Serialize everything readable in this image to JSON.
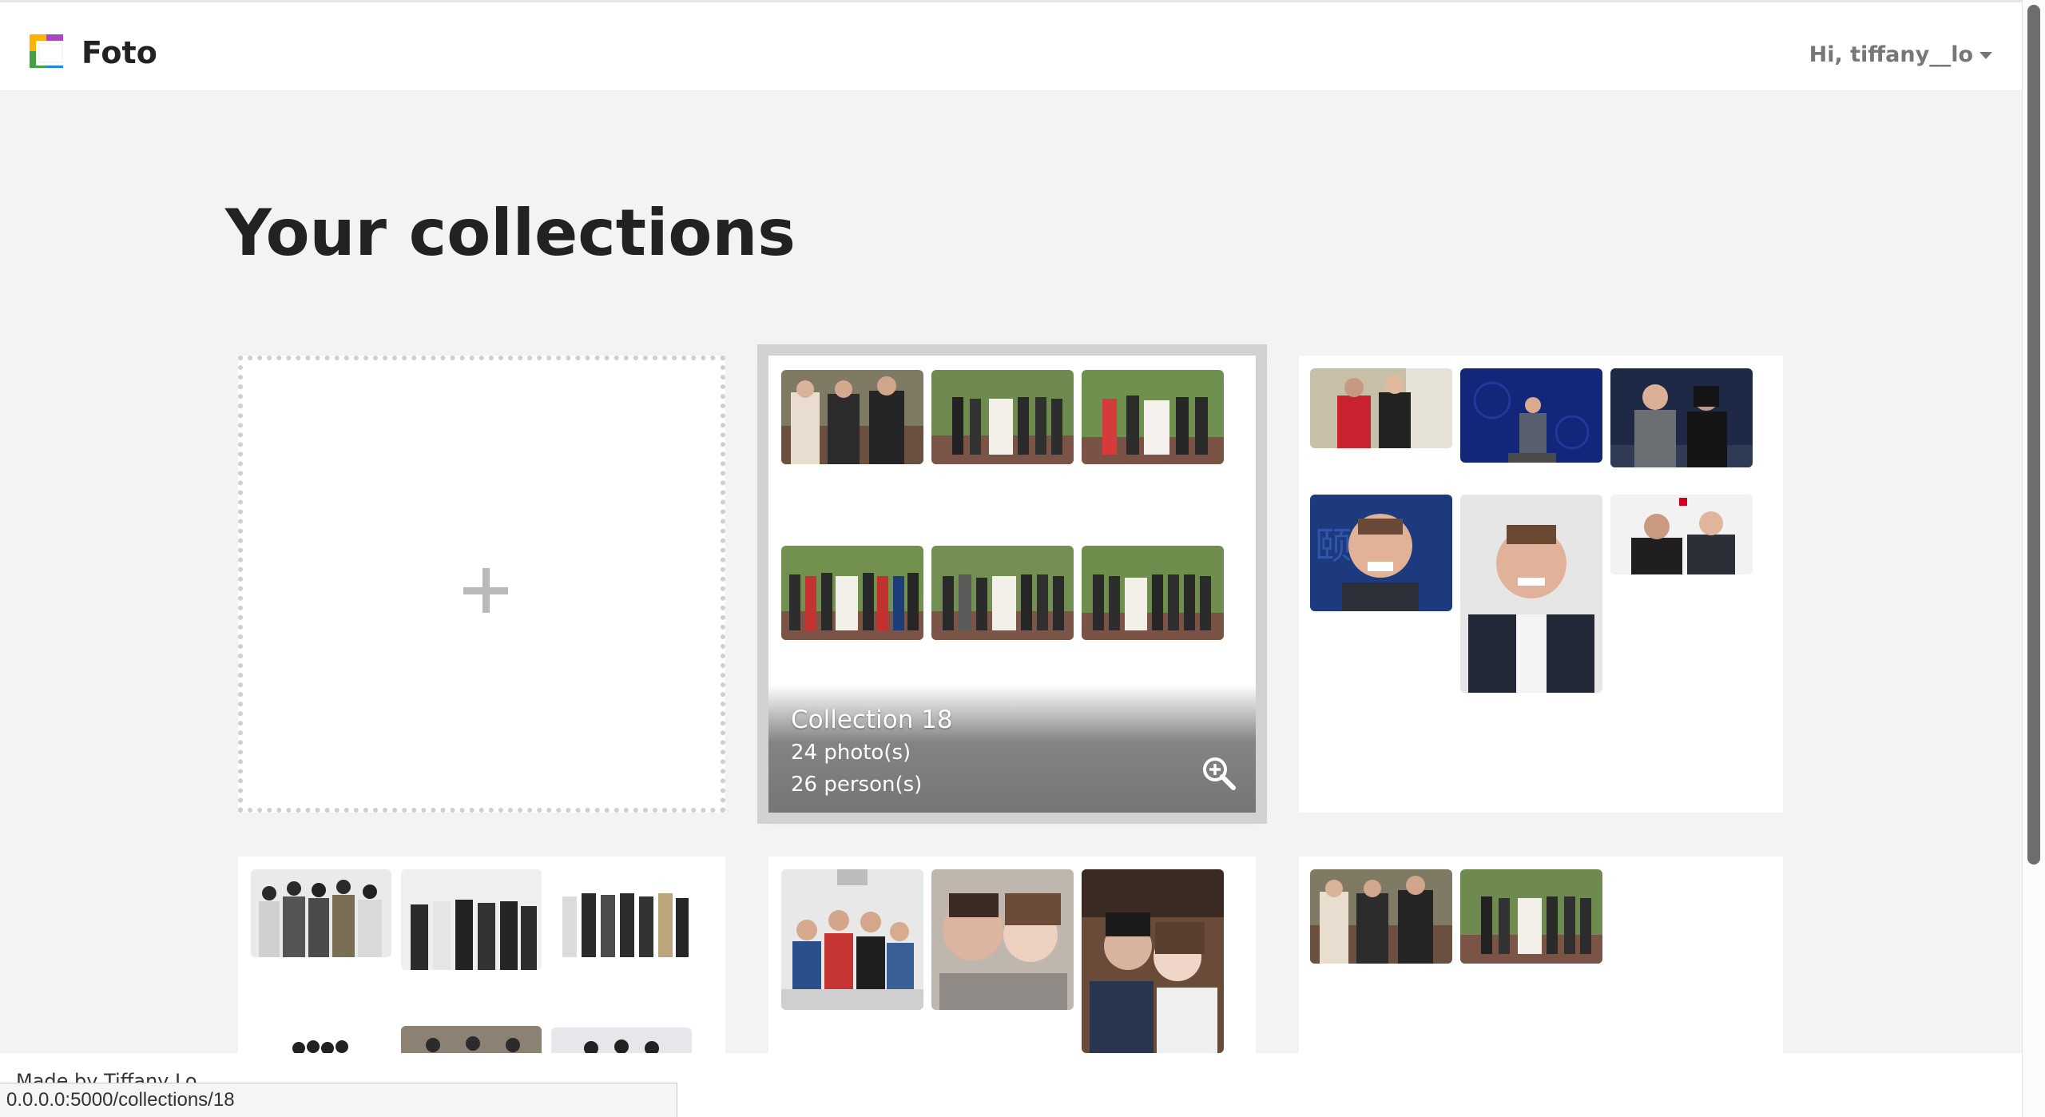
{
  "app": {
    "brand": "Foto",
    "user_greeting": "Hi, tiffany__lo"
  },
  "page": {
    "title": "Your collections"
  },
  "hovered_collection": {
    "name": "Collection 18",
    "photos": "24 photo(s)",
    "persons": "26 person(s)"
  },
  "footer": {
    "text": "Made by Tiffany Lo"
  },
  "status_bar": {
    "url": "0.0.0.0:5000/collections/18"
  },
  "icons": {
    "add": "plus-icon",
    "zoom": "zoom-in-icon",
    "menu": "caret-down-icon"
  },
  "colors": {
    "page_background": "#f3f3f3",
    "card_background": "#ffffff",
    "muted_text": "#777777"
  }
}
